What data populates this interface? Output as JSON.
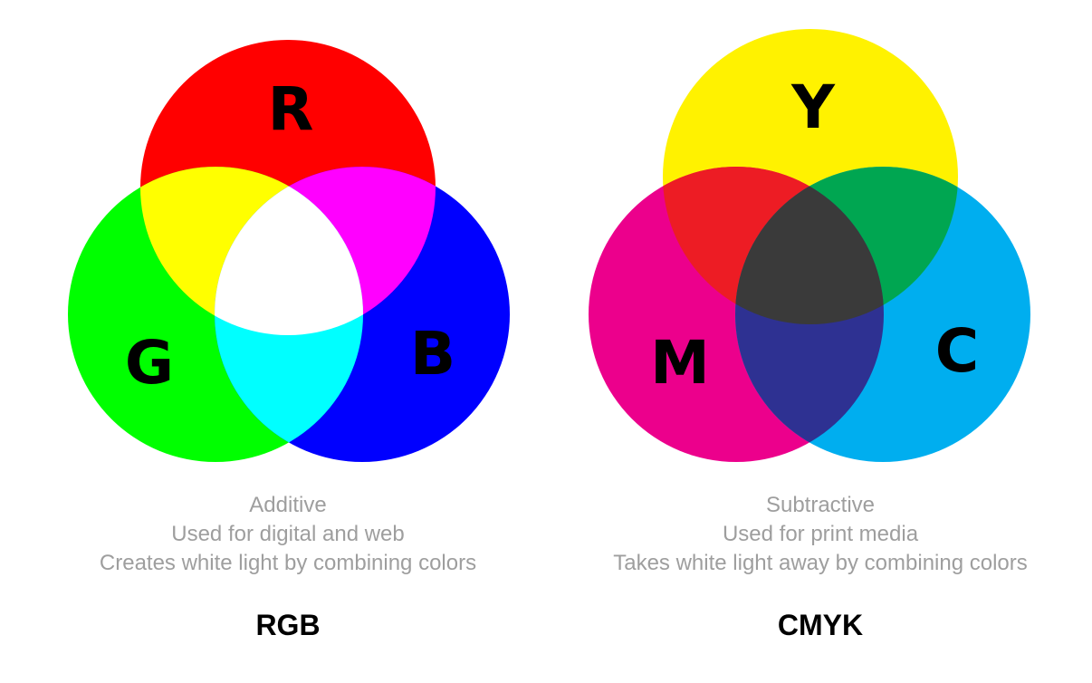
{
  "rgb": {
    "letters": {
      "red": "R",
      "green": "G",
      "blue": "B"
    },
    "colors": {
      "red": "#ff0000",
      "green": "#00ff00",
      "blue": "#0000ff",
      "yellow_overlap": "#ffff00",
      "magenta_overlap": "#ff00ff",
      "cyan_overlap": "#00ffff",
      "center": "#ffffff"
    },
    "description": [
      "Additive",
      "Used for digital and web",
      "Creates white light by combining colors"
    ],
    "title": "RGB"
  },
  "cmyk": {
    "letters": {
      "yellow": "Y",
      "magenta": "M",
      "cyan": "C"
    },
    "colors": {
      "yellow": "#fff200",
      "magenta": "#ec008c",
      "cyan": "#00aeef",
      "red_overlap": "#ed1c24",
      "green_overlap": "#00a651",
      "blue_overlap": "#2e3192",
      "center": "#3a3a3a"
    },
    "description": [
      "Subtractive",
      "Used for print media",
      "Takes white light away by combining colors"
    ],
    "title": "CMYK"
  },
  "text_color": "#9e9e9e"
}
